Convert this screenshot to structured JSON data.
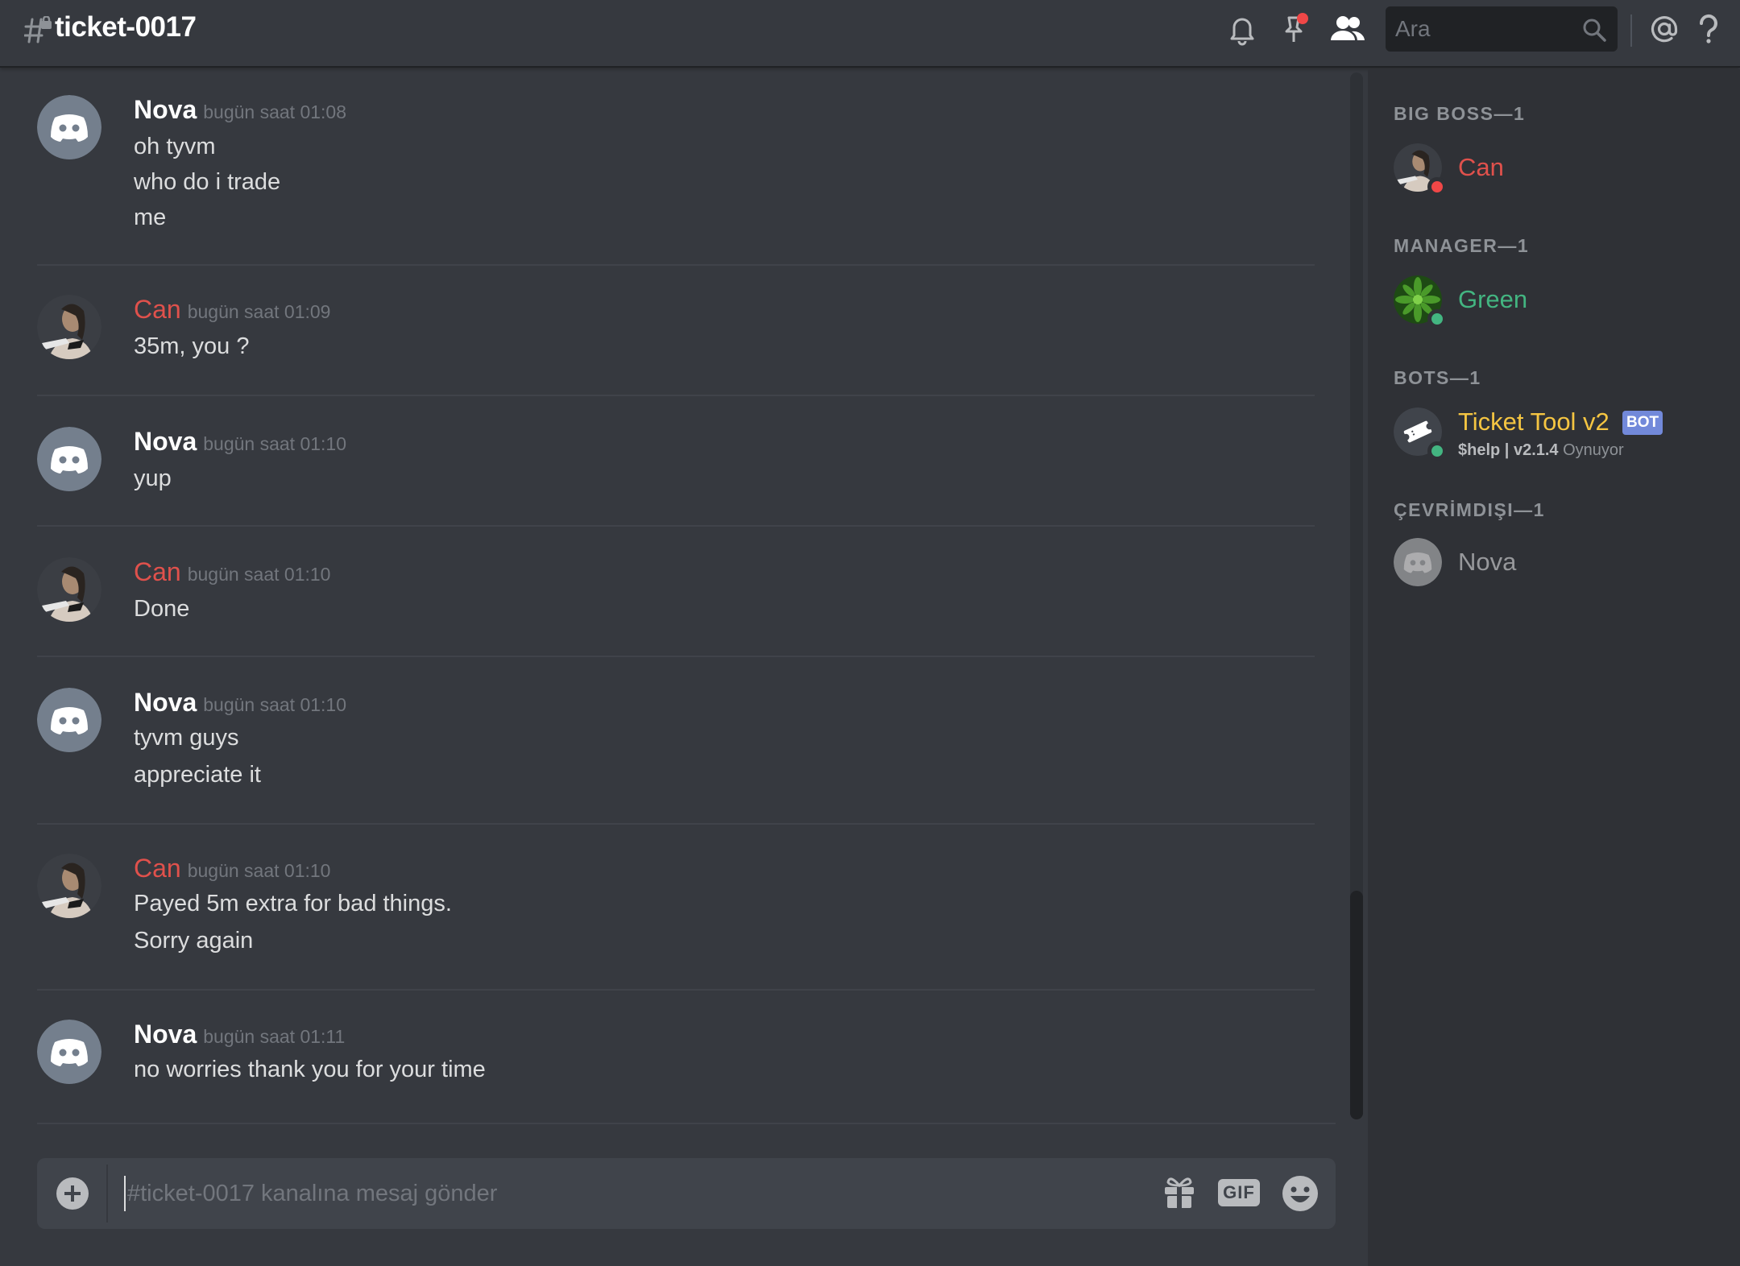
{
  "header": {
    "channel_name": "ticket-0017",
    "search_placeholder": "Ara"
  },
  "colors": {
    "background": "#36393f",
    "sidebar": "#2f3136",
    "mention_red": "#e0514c",
    "online": "#43b581",
    "dnd": "#f04747",
    "bot_yellow": "#f5c542",
    "green_role": "#43b581",
    "bot_badge": "#7289da"
  },
  "messages": [
    {
      "author": "Nova",
      "avatar": "discord-default-avatar",
      "timestamp": "bugün saat 01:08",
      "lines": [
        "oh tyvm",
        "who do i trade",
        "me"
      ]
    },
    {
      "author": "Can",
      "avatar": "can-avatar",
      "timestamp": "bugün saat 01:09",
      "lines": [
        "35m, you ?"
      ]
    },
    {
      "author": "Nova",
      "avatar": "discord-default-avatar",
      "timestamp": "bugün saat 01:10",
      "lines": [
        "yup"
      ]
    },
    {
      "author": "Can",
      "avatar": "can-avatar",
      "timestamp": "bugün saat 01:10",
      "lines": [
        "Done"
      ]
    },
    {
      "author": "Nova",
      "avatar": "discord-default-avatar",
      "timestamp": "bugün saat 01:10",
      "lines": [
        "tyvm guys",
        "appreciate it"
      ]
    },
    {
      "author": "Can",
      "avatar": "can-avatar",
      "timestamp": "bugün saat 01:10",
      "lines": [
        "Payed 5m extra for bad things.",
        "Sorry again"
      ]
    },
    {
      "author": "Nova",
      "avatar": "discord-default-avatar",
      "timestamp": "bugün saat 01:11",
      "lines": [
        "no worries thank you for your time"
      ]
    }
  ],
  "composer": {
    "placeholder": "#ticket-0017 kanalına mesaj gönder",
    "gif_label": "GIF"
  },
  "members": {
    "sections": [
      {
        "title": "BIG BOSS—1",
        "members": [
          {
            "name": "Can",
            "status": "dnd"
          }
        ]
      },
      {
        "title": "MANAGER—1",
        "members": [
          {
            "name": "Green",
            "status": "online"
          }
        ]
      },
      {
        "title": "BOTS—1",
        "members": [
          {
            "name": "Ticket Tool v2",
            "badge": "BOT",
            "status": "online",
            "activity_bold": "$help | v2.1.4",
            "activity_verb": "Oynuyor"
          }
        ]
      },
      {
        "title": "ÇEVRİMDIŞI—1",
        "members": [
          {
            "name": "Nova",
            "status": "offline"
          }
        ]
      }
    ]
  }
}
